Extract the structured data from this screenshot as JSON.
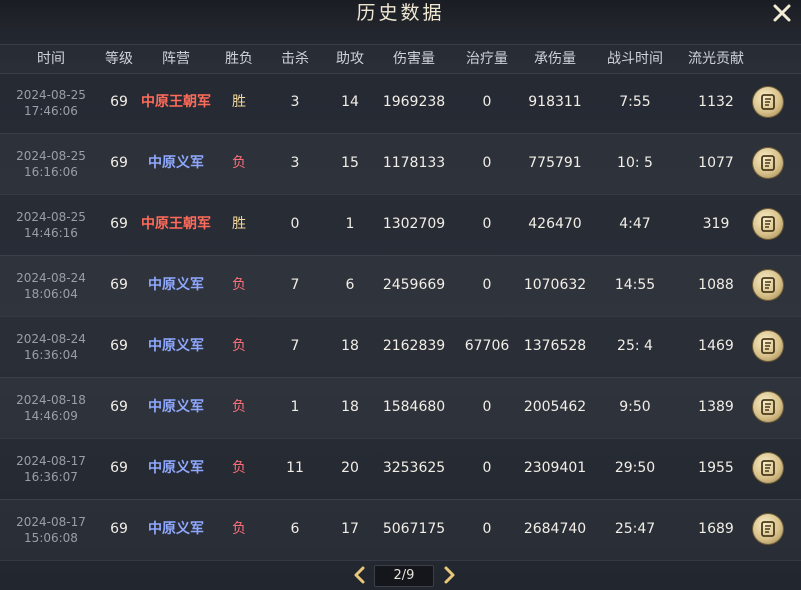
{
  "window": {
    "title": "历史数据",
    "close_icon": "close-icon"
  },
  "columns": [
    "时间",
    "等级",
    "阵营",
    "胜负",
    "击杀",
    "助攻",
    "伤害量",
    "治疗量",
    "承伤量",
    "战斗时间",
    "流光贡献"
  ],
  "rows": [
    {
      "date": "2024-08-25",
      "time": "17:46:06",
      "level": "69",
      "camp": "中原王朝军",
      "camp_color": "#ff6b5a",
      "result": "胜",
      "kills": "3",
      "assists": "14",
      "damage": "1969238",
      "healing": "0",
      "taken": "918311",
      "duration": "7:55",
      "contrib": "1132"
    },
    {
      "date": "2024-08-25",
      "time": "16:16:06",
      "level": "69",
      "camp": "中原义军",
      "camp_color": "#8fa8ff",
      "result": "负",
      "kills": "3",
      "assists": "15",
      "damage": "1178133",
      "healing": "0",
      "taken": "775791",
      "duration": "10: 5",
      "contrib": "1077"
    },
    {
      "date": "2024-08-25",
      "time": "14:46:16",
      "level": "69",
      "camp": "中原王朝军",
      "camp_color": "#ff6b5a",
      "result": "胜",
      "kills": "0",
      "assists": "1",
      "damage": "1302709",
      "healing": "0",
      "taken": "426470",
      "duration": "4:47",
      "contrib": "319"
    },
    {
      "date": "2024-08-24",
      "time": "18:06:04",
      "level": "69",
      "camp": "中原义军",
      "camp_color": "#8fa8ff",
      "result": "负",
      "kills": "7",
      "assists": "6",
      "damage": "2459669",
      "healing": "0",
      "taken": "1070632",
      "duration": "14:55",
      "contrib": "1088"
    },
    {
      "date": "2024-08-24",
      "time": "16:36:04",
      "level": "69",
      "camp": "中原义军",
      "camp_color": "#8fa8ff",
      "result": "负",
      "kills": "7",
      "assists": "18",
      "damage": "2162839",
      "healing": "67706",
      "taken": "1376528",
      "duration": "25: 4",
      "contrib": "1469"
    },
    {
      "date": "2024-08-18",
      "time": "14:46:09",
      "level": "69",
      "camp": "中原义军",
      "camp_color": "#8fa8ff",
      "result": "负",
      "kills": "1",
      "assists": "18",
      "damage": "1584680",
      "healing": "0",
      "taken": "2005462",
      "duration": "9:50",
      "contrib": "1389"
    },
    {
      "date": "2024-08-17",
      "time": "16:36:07",
      "level": "69",
      "camp": "中原义军",
      "camp_color": "#8fa8ff",
      "result": "负",
      "kills": "11",
      "assists": "20",
      "damage": "3253625",
      "healing": "0",
      "taken": "2309401",
      "duration": "29:50",
      "contrib": "1955"
    },
    {
      "date": "2024-08-17",
      "time": "15:06:08",
      "level": "69",
      "camp": "中原义军",
      "camp_color": "#8fa8ff",
      "result": "负",
      "kills": "6",
      "assists": "17",
      "damage": "5067175",
      "healing": "0",
      "taken": "2684740",
      "duration": "25:47",
      "contrib": "1689"
    }
  ],
  "row_action_icon": "scroll-detail-icon",
  "pagination": {
    "label": "2/9",
    "current_page": 2,
    "total_pages": 9,
    "prev_icon": "chevron-left-icon",
    "next_icon": "chevron-right-icon"
  },
  "colors": {
    "accent_gold": "#e9c77a",
    "win": "#f4d79a",
    "lose": "#ff6e7a"
  }
}
